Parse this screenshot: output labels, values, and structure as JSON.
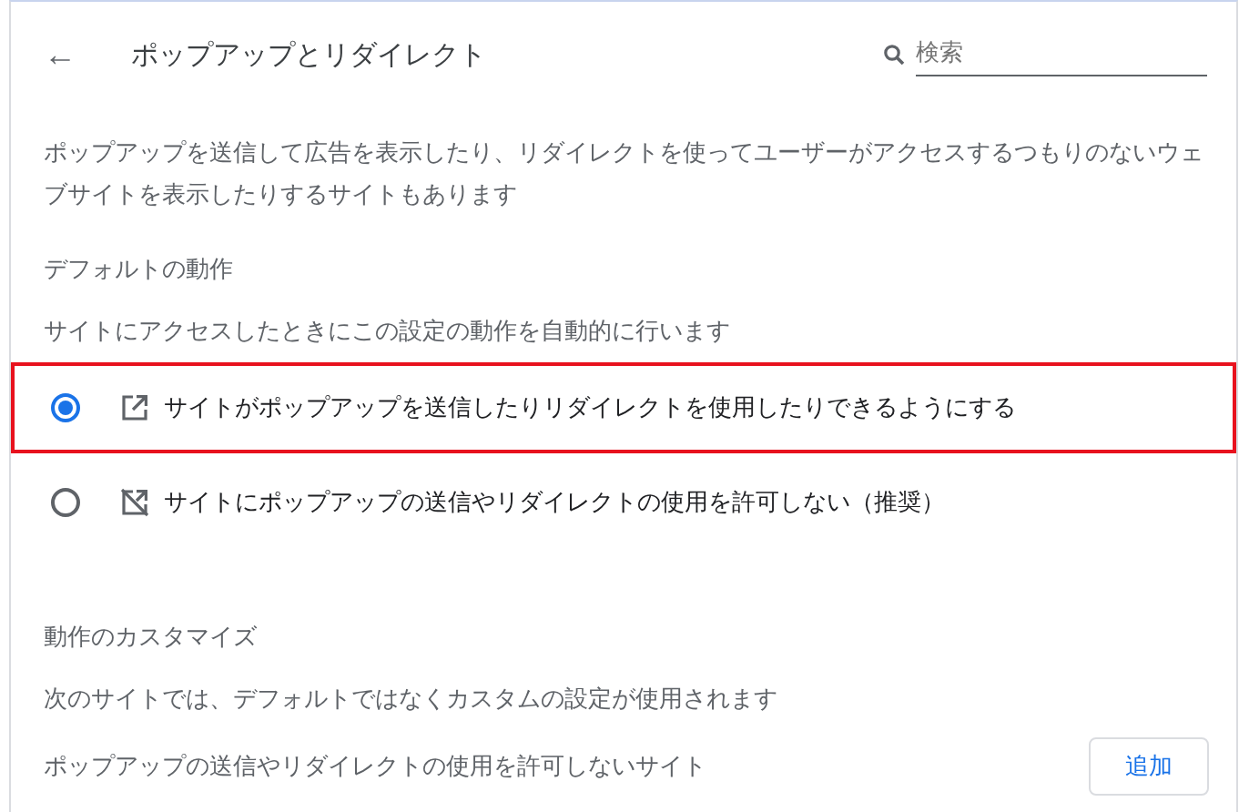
{
  "header": {
    "back": "←",
    "title": "ポップアップとリダイレクト",
    "search": {
      "placeholder": "検索"
    }
  },
  "description": "ポップアップを送信して広告を表示したり、リダイレクトを使ってユーザーがアクセスするつもりのないウェブサイトを表示したりするサイトもあります",
  "default_section": {
    "title": "デフォルトの動作",
    "subtitle": "サイトにアクセスしたときにこの設定の動作を自動的に行います",
    "options": [
      {
        "kind": "allow",
        "label": "サイトがポップアップを送信したりリダイレクトを使用したりできるようにする",
        "selected": true,
        "highlighted": true
      },
      {
        "kind": "block",
        "label": "サイトにポップアップの送信やリダイレクトの使用を許可しない（推奨）",
        "selected": false,
        "highlighted": false
      }
    ]
  },
  "custom_section": {
    "title": "動作のカスタマイズ",
    "subtitle": "次のサイトでは、デフォルトではなくカスタムの設定が使用されます",
    "list_title": "ポップアップの送信やリダイレクトの使用を許可しないサイト",
    "add_button": "追加"
  }
}
